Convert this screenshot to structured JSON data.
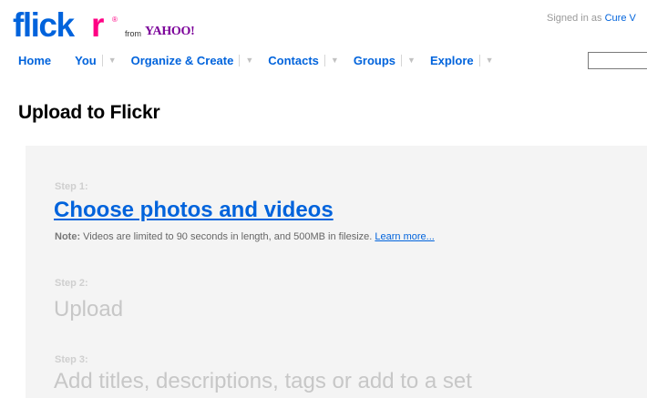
{
  "brand": {
    "logo_flick": "flick",
    "logo_r": "r",
    "registered": "®",
    "from": "from",
    "yahoo": "YAHOO!",
    "colors": {
      "blue": "#0063dc",
      "pink": "#ff0084",
      "yahoo_purple": "#7b0099"
    }
  },
  "header": {
    "signed_in_prefix": "Signed in as",
    "user": "Cure V"
  },
  "nav": {
    "items": [
      {
        "label": "Home",
        "dropdown": false
      },
      {
        "label": "You",
        "dropdown": true
      },
      {
        "label": "Organize & Create",
        "dropdown": true
      },
      {
        "label": "Contacts",
        "dropdown": true
      },
      {
        "label": "Groups",
        "dropdown": true
      },
      {
        "label": "Explore",
        "dropdown": true
      }
    ],
    "caret_icon": "chevron-down-icon",
    "search_value": ""
  },
  "page": {
    "title": "Upload to Flickr"
  },
  "steps": [
    {
      "label": "Step 1:",
      "title": "Choose photos and videos",
      "active": true
    },
    {
      "label": "Step 2:",
      "title": "Upload",
      "active": false
    },
    {
      "label": "Step 3:",
      "title": "Add titles, descriptions, tags or add to a set",
      "active": false
    }
  ],
  "note": {
    "prefix": "Note:",
    "text": "Videos are limited to 90 seconds in length, and 500MB in filesize.",
    "link": "Learn more..."
  }
}
